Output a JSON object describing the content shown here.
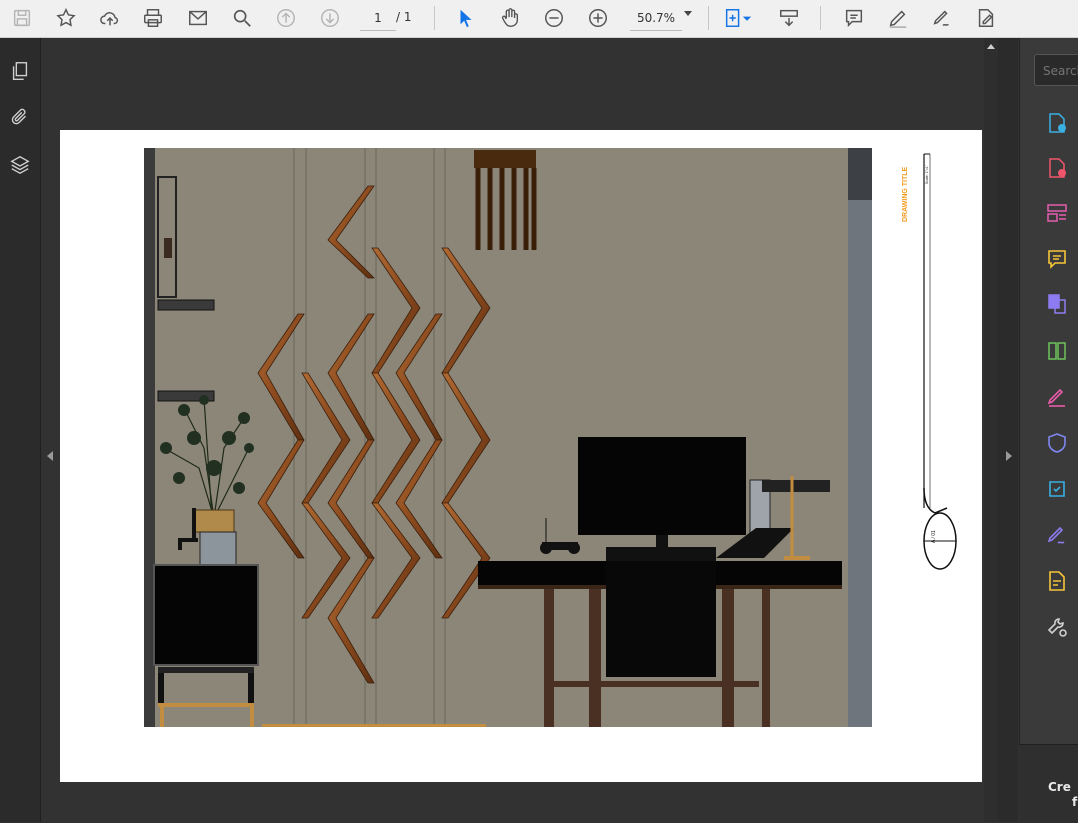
{
  "toolbar": {
    "page_current": "1",
    "page_total": "/ 1",
    "zoom": "50.7%",
    "icons": [
      "save-icon",
      "bookmark-star-icon",
      "upload-cloud-icon",
      "print-icon",
      "email-icon",
      "zoom-search-icon",
      "page-up-icon",
      "page-down-icon",
      "select-cursor-icon",
      "hand-pan-icon",
      "zoom-out-icon",
      "zoom-in-icon",
      "fit-page-icon",
      "scroll-mode-icon",
      "comment-icon",
      "highlight-pen-icon",
      "sign-icon",
      "fill-sign-icon"
    ]
  },
  "left_rail": {
    "icons": [
      "page-thumbnails-icon",
      "attachments-icon",
      "layers-icon"
    ]
  },
  "right_panel": {
    "search_placeholder": "Search",
    "tools": [
      "export-pdf-icon",
      "create-pdf-icon",
      "edit-pdf-icon",
      "comment-tool-icon",
      "combine-files-icon",
      "organize-pages-icon",
      "fill-sign-tool-icon",
      "protect-icon",
      "scan-ocr-icon",
      "request-signature-icon",
      "send-comments-icon",
      "more-tools-icon"
    ],
    "promo_line1": "Cre",
    "promo_line2": "f"
  },
  "document": {
    "title_block": {
      "drawing_title": "DRAWING TITLE",
      "scale": "Scale: 1\"=1'",
      "tag": "A / 01"
    }
  },
  "colors": {
    "accent": "#1473e6",
    "wall": "#8c8678",
    "wood": "#8b4a1e",
    "orange_label": "#f39a1d"
  }
}
